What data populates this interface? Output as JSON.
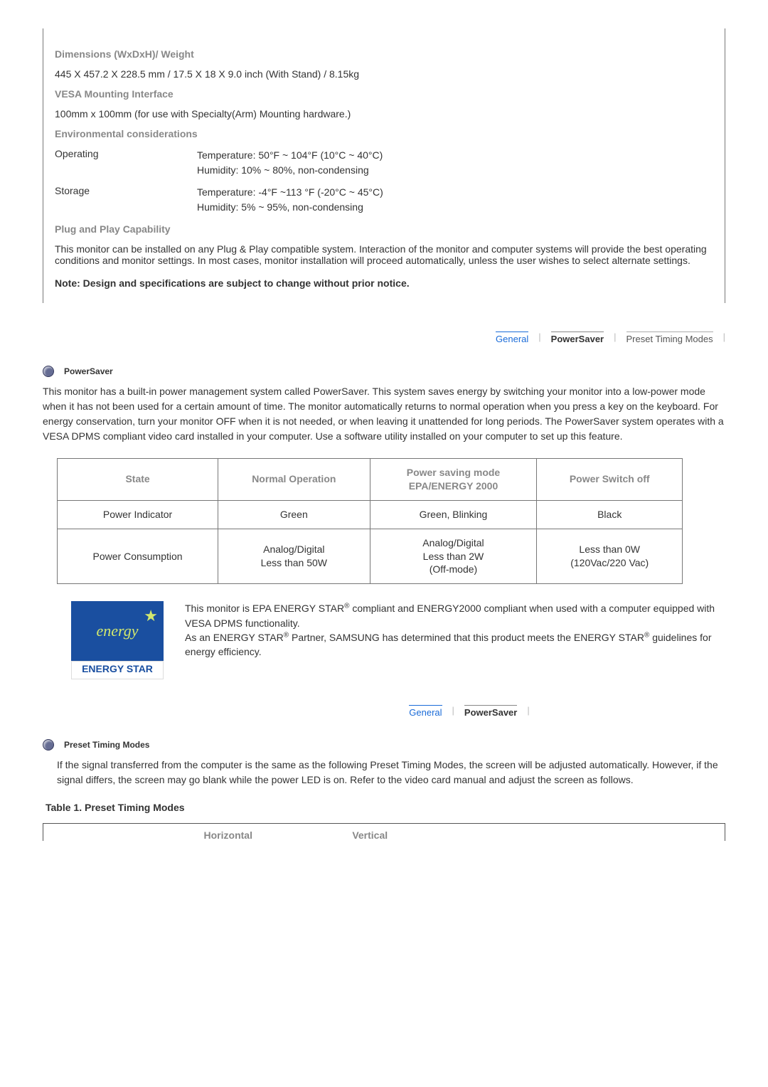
{
  "specs": {
    "dimensions_head": "Dimensions (WxDxH)/ Weight",
    "dimensions_val": "445 X 457.2 X 228.5 mm / 17.5 X 18 X 9.0 inch  (With Stand) / 8.15kg",
    "vesa_head": "VESA Mounting Interface",
    "vesa_val": "100mm x 100mm (for use with Specialty(Arm) Mounting hardware.)",
    "env_head": "Environmental considerations",
    "env_operating_label": "Operating",
    "env_operating_val": "Temperature: 50°F ~ 104°F (10°C ~ 40°C)\nHumidity: 10% ~ 80%, non-condensing",
    "env_storage_label": "Storage",
    "env_storage_val": "Temperature: -4°F ~113 °F (-20°C ~ 45°C)\nHumidity: 5% ~ 95%, non-condensing",
    "pnp_head": "Plug and Play Capability",
    "pnp_body": "This monitor can be installed on any Plug & Play compatible system. Interaction of the monitor and computer systems will provide the best operating conditions and monitor settings. In most cases, monitor installation will proceed automatically, unless the user wishes to select alternate settings.",
    "note": "Note: Design and specifications are subject to change without prior notice."
  },
  "tabs1": {
    "general": "General",
    "powersaver": "PowerSaver",
    "preset": "Preset Timing Modes"
  },
  "powersaver": {
    "heading": "PowerSaver",
    "body": "This monitor has a built-in power management system called PowerSaver. This system saves energy by switching your monitor into a low-power mode when it has not been used for a certain amount of time. The monitor automatically returns to normal operation when you press a key on the keyboard. For energy conservation, turn your monitor OFF when it is not needed, or when leaving it unattended for long periods. The PowerSaver system operates with a VESA DPMS compliant video card installed in your computer. Use a software utility installed on your computer to set up this feature."
  },
  "power_table": {
    "h_state": "State",
    "h_normal": "Normal Operation",
    "h_saving": "Power saving mode\nEPA/ENERGY 2000",
    "h_off": "Power Switch off",
    "r1_label": "Power Indicator",
    "r1_normal": "Green",
    "r1_saving": "Green, Blinking",
    "r1_off": "Black",
    "r2_label": "Power Consumption",
    "r2_normal": "Analog/Digital\nLess than 50W",
    "r2_saving": "Analog/Digital\nLess than 2W\n(Off-mode)",
    "r2_off": "Less than 0W\n(120Vac/220 Vac)"
  },
  "energy": {
    "logo_top": "energy",
    "logo_bot": "ENERGY STAR",
    "p1a": "This monitor is EPA ENERGY STAR",
    "p1b": " compliant and ENERGY2000 compliant when used with a computer equipped with VESA DPMS functionality.",
    "p2a": "As an ENERGY STAR",
    "p2b": " Partner, SAMSUNG has determined that this product meets the ENERGY STAR",
    "p2c": " guidelines for energy efficiency."
  },
  "tabs2": {
    "general": "General",
    "powersaver": "PowerSaver"
  },
  "preset": {
    "heading": "Preset Timing Modes",
    "body": "If the signal transferred from the computer is the same as the following Preset Timing Modes, the screen will be adjusted automatically. However, if the signal differs, the screen may go blank while the power LED is on. Refer to the video card manual and adjust the screen as follows.",
    "table_title": "Table 1. Preset Timing Modes",
    "col_h": "Horizontal",
    "col_v": "Vertical"
  }
}
